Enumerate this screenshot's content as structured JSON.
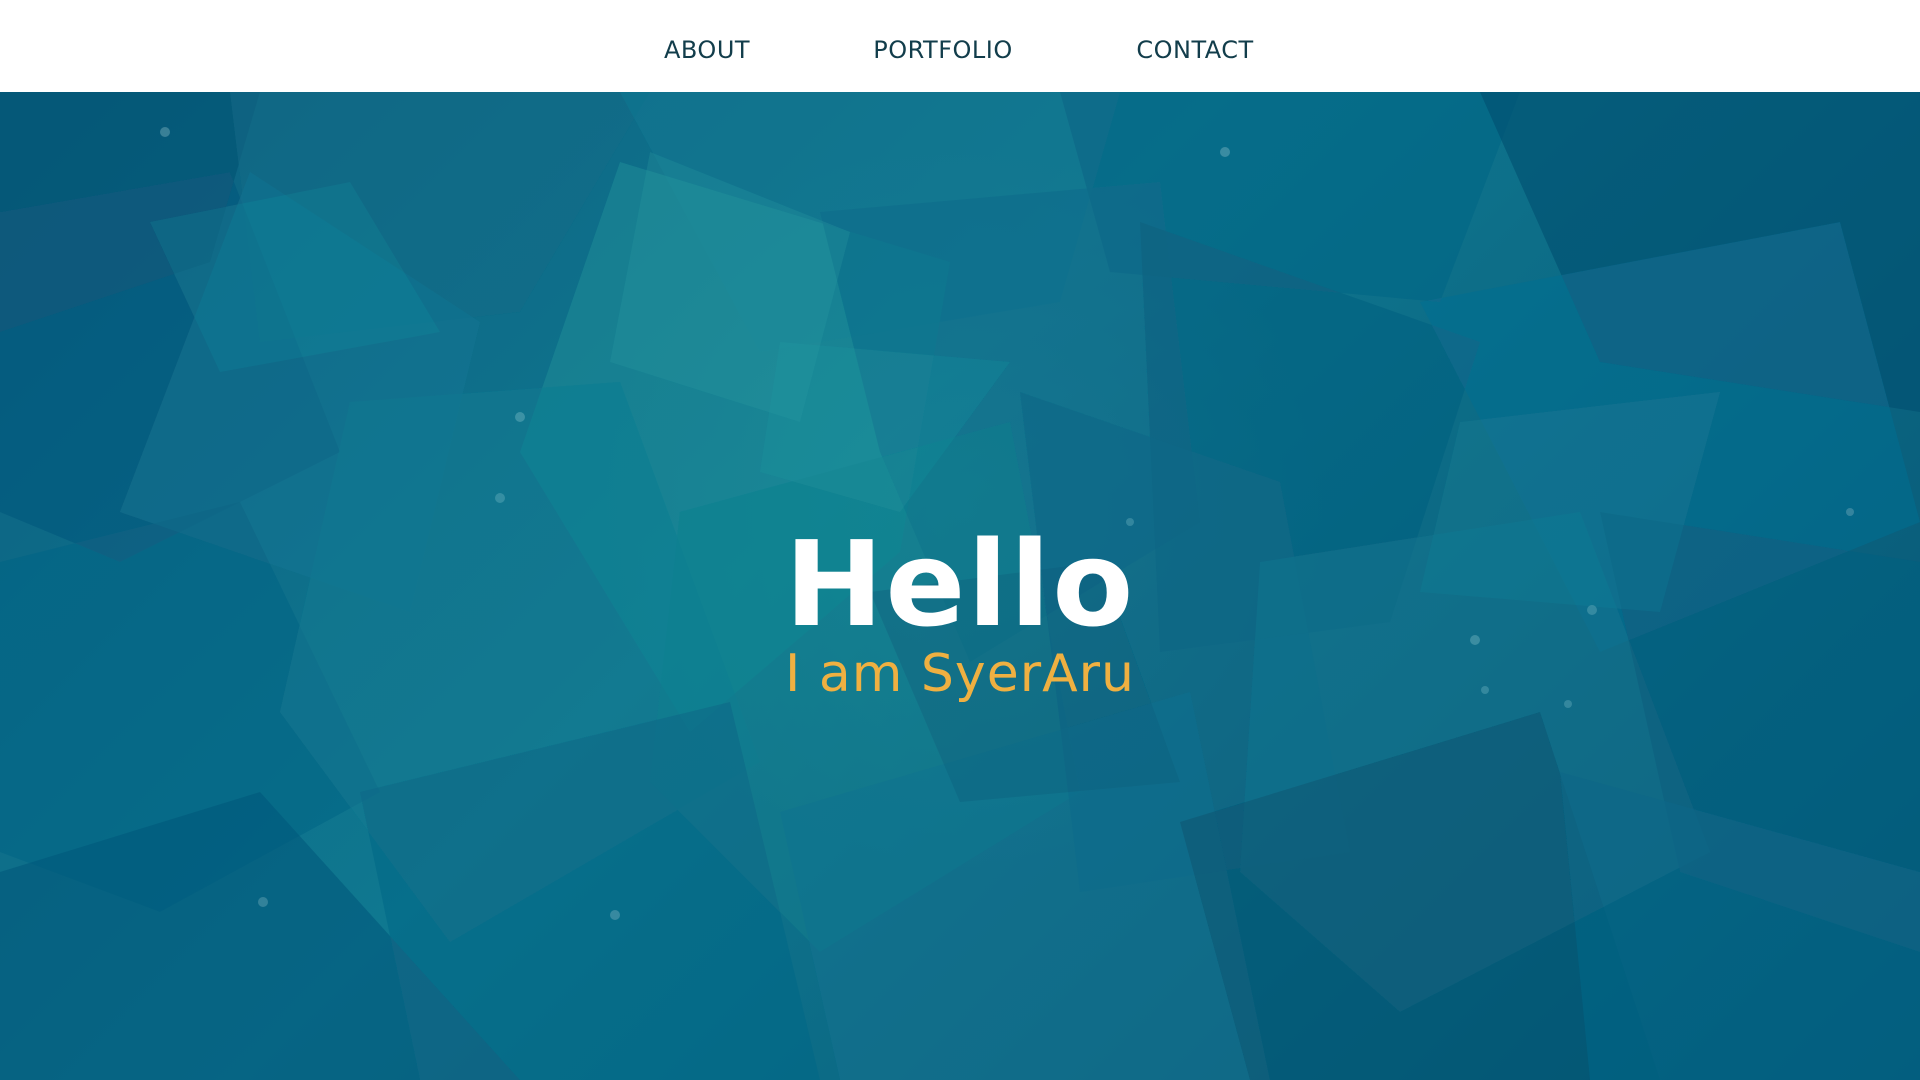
{
  "nav": {
    "links": [
      {
        "label": "ABOUT"
      },
      {
        "label": "PORTFOLIO"
      },
      {
        "label": "CONTACT"
      }
    ]
  },
  "hero": {
    "title": "Hello",
    "subtitle": "I am SyerAru"
  },
  "colors": {
    "nav_background": "#ffffff",
    "nav_text": "#123d4b",
    "hero_background": "#0b6b88",
    "hero_title": "#ffffff",
    "hero_subtitle": "#efb041"
  },
  "background": {
    "pattern": "layered teal geometric shards with faint dots"
  }
}
